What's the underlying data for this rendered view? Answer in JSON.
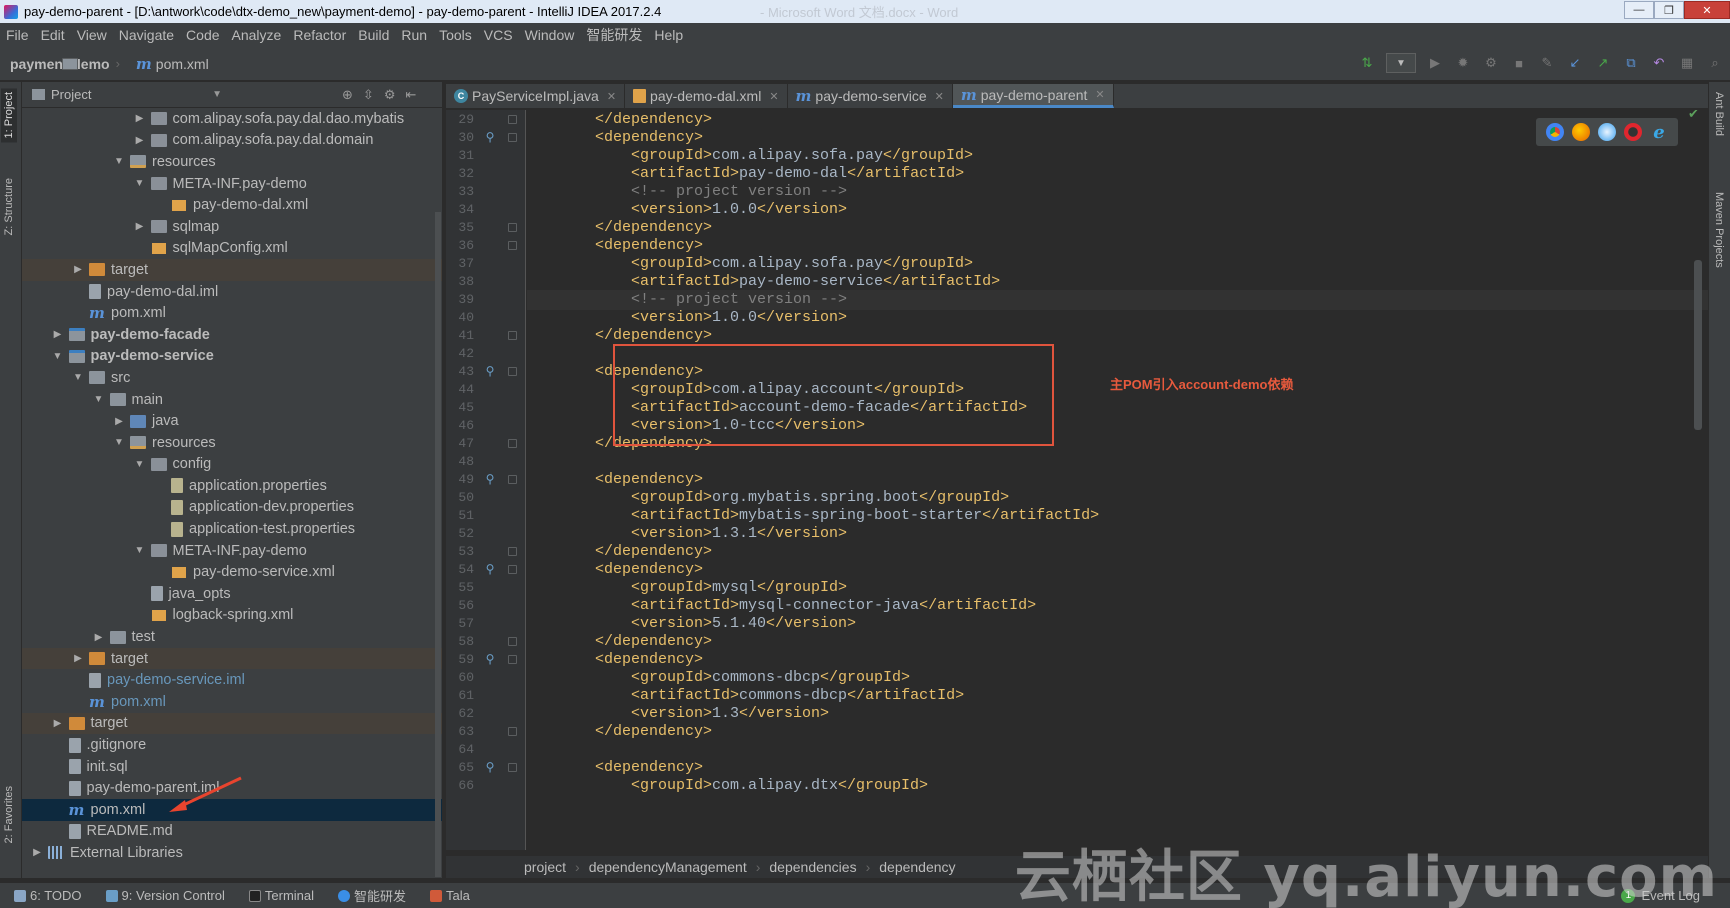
{
  "window": {
    "title": "pay-demo-parent - [D:\\antwork\\code\\dtx-demo_new\\payment-demo] - pay-demo-parent - IntelliJ IDEA 2017.2.4",
    "ghost_text": "- Microsoft Word 文档.docx - Word",
    "min_label": "—",
    "max_label": "❐",
    "close_label": "✕"
  },
  "menu": [
    "File",
    "Edit",
    "View",
    "Navigate",
    "Code",
    "Analyze",
    "Refactor",
    "Build",
    "Run",
    "Tools",
    "VCS",
    "Window",
    "智能研发",
    "Help"
  ],
  "navbar": {
    "project": "payment-demo",
    "file": "pom.xml"
  },
  "left_stripe": {
    "project": "1: Project",
    "structure": "Z: Structure",
    "favorites": "2: Favorites"
  },
  "right_stripe": {
    "ant": "Ant Build",
    "maven": "Maven Projects"
  },
  "project_panel": {
    "title": "Project",
    "tree": [
      {
        "label": "com.alipay.sofa.pay.dal.dao.mybatis",
        "icon": "package",
        "depth": 5,
        "arrow": "▶"
      },
      {
        "label": "com.alipay.sofa.pay.dal.domain",
        "icon": "package",
        "depth": 5,
        "arrow": "▶"
      },
      {
        "label": "resources",
        "icon": "resources-folder",
        "depth": 4,
        "arrow": "▼"
      },
      {
        "label": "META-INF.pay-demo",
        "icon": "package",
        "depth": 5,
        "arrow": "▼"
      },
      {
        "label": "pay-demo-dal.xml",
        "icon": "xml",
        "depth": 6,
        "arrow": ""
      },
      {
        "label": "sqlmap",
        "icon": "package",
        "depth": 5,
        "arrow": "▶"
      },
      {
        "label": "sqlMapConfig.xml",
        "icon": "xml",
        "depth": 5,
        "arrow": ""
      },
      {
        "label": "target",
        "icon": "target",
        "depth": 2,
        "arrow": "▶",
        "highlight": true
      },
      {
        "label": "pay-demo-dal.iml",
        "icon": "file",
        "depth": 2,
        "arrow": ""
      },
      {
        "label": "pom.xml",
        "icon": "maven",
        "depth": 2,
        "arrow": ""
      },
      {
        "label": "pay-demo-facade",
        "icon": "module",
        "depth": 1,
        "arrow": "▶",
        "bold": true
      },
      {
        "label": "pay-demo-service",
        "icon": "module",
        "depth": 1,
        "arrow": "▼",
        "bold": true
      },
      {
        "label": "src",
        "icon": "folder",
        "depth": 2,
        "arrow": "▼"
      },
      {
        "label": "main",
        "icon": "folder",
        "depth": 3,
        "arrow": "▼"
      },
      {
        "label": "java",
        "icon": "source-folder",
        "depth": 4,
        "arrow": "▶"
      },
      {
        "label": "resources",
        "icon": "resources-folder",
        "depth": 4,
        "arrow": "▼"
      },
      {
        "label": "config",
        "icon": "package",
        "depth": 5,
        "arrow": "▼"
      },
      {
        "label": "application.properties",
        "icon": "properties",
        "depth": 6,
        "arrow": ""
      },
      {
        "label": "application-dev.properties",
        "icon": "properties",
        "depth": 6,
        "arrow": ""
      },
      {
        "label": "application-test.properties",
        "icon": "properties",
        "depth": 6,
        "arrow": ""
      },
      {
        "label": "META-INF.pay-demo",
        "icon": "package",
        "depth": 5,
        "arrow": "▼"
      },
      {
        "label": "pay-demo-service.xml",
        "icon": "xml",
        "depth": 6,
        "arrow": ""
      },
      {
        "label": "java_opts",
        "icon": "file",
        "depth": 5,
        "arrow": ""
      },
      {
        "label": "logback-spring.xml",
        "icon": "xml",
        "depth": 5,
        "arrow": ""
      },
      {
        "label": "test",
        "icon": "folder",
        "depth": 3,
        "arrow": "▶"
      },
      {
        "label": "target",
        "icon": "target",
        "depth": 2,
        "arrow": "▶",
        "highlight": true
      },
      {
        "label": "pay-demo-service.iml",
        "icon": "file",
        "depth": 2,
        "arrow": "",
        "blue": true
      },
      {
        "label": "pom.xml",
        "icon": "maven",
        "depth": 2,
        "arrow": "",
        "blue": true
      },
      {
        "label": "target",
        "icon": "target",
        "depth": 1,
        "arrow": "▶",
        "highlight": true
      },
      {
        "label": ".gitignore",
        "icon": "file",
        "depth": 1,
        "arrow": ""
      },
      {
        "label": "init.sql",
        "icon": "file",
        "depth": 1,
        "arrow": ""
      },
      {
        "label": "pay-demo-parent.iml",
        "icon": "file",
        "depth": 1,
        "arrow": ""
      },
      {
        "label": "pom.xml",
        "icon": "maven",
        "depth": 1,
        "arrow": "",
        "selected": true
      },
      {
        "label": "README.md",
        "icon": "file",
        "depth": 1,
        "arrow": ""
      },
      {
        "label": "External Libraries",
        "icon": "library",
        "depth": 0,
        "arrow": "▶"
      }
    ]
  },
  "tabs": [
    {
      "label": "PayServiceImpl.java",
      "icon": "class"
    },
    {
      "label": "pay-demo-dal.xml",
      "icon": "xml"
    },
    {
      "label": "pay-demo-service",
      "icon": "maven"
    },
    {
      "label": "pay-demo-parent",
      "icon": "maven",
      "active": true
    }
  ],
  "editor": {
    "first_line": 29,
    "lines": [
      {
        "indent": 2,
        "segs": [
          [
            "tag",
            "</dependency>"
          ]
        ]
      },
      {
        "indent": 2,
        "segs": [
          [
            "tag",
            "<dependency>"
          ]
        ],
        "mark": true
      },
      {
        "indent": 3,
        "segs": [
          [
            "tag",
            "<groupId>"
          ],
          [
            "val",
            "com.alipay.sofa.pay"
          ],
          [
            "tag",
            "</groupId>"
          ]
        ]
      },
      {
        "indent": 3,
        "segs": [
          [
            "tag",
            "<artifactId>"
          ],
          [
            "val",
            "pay-demo-dal"
          ],
          [
            "tag",
            "</artifactId>"
          ]
        ]
      },
      {
        "indent": 3,
        "segs": [
          [
            "cmt",
            "<!-- project version -->"
          ]
        ]
      },
      {
        "indent": 3,
        "segs": [
          [
            "tag",
            "<version>"
          ],
          [
            "val",
            "1.0.0"
          ],
          [
            "tag",
            "</version>"
          ]
        ]
      },
      {
        "indent": 2,
        "segs": [
          [
            "tag",
            "</dependency>"
          ]
        ]
      },
      {
        "indent": 2,
        "segs": [
          [
            "tag",
            "<dependency>"
          ]
        ]
      },
      {
        "indent": 3,
        "segs": [
          [
            "tag",
            "<groupId>"
          ],
          [
            "val",
            "com.alipay.sofa.pay"
          ],
          [
            "tag",
            "</groupId>"
          ]
        ]
      },
      {
        "indent": 3,
        "segs": [
          [
            "tag",
            "<artifactId>"
          ],
          [
            "val",
            "pay-demo-service"
          ],
          [
            "tag",
            "</artifactId>"
          ]
        ]
      },
      {
        "indent": 3,
        "segs": [
          [
            "cmt",
            "<!-- project version -->"
          ]
        ],
        "current": true
      },
      {
        "indent": 3,
        "segs": [
          [
            "tag",
            "<version>"
          ],
          [
            "val",
            "1.0.0"
          ],
          [
            "tag",
            "</version>"
          ]
        ]
      },
      {
        "indent": 2,
        "segs": [
          [
            "tag",
            "</dependency>"
          ]
        ]
      },
      {
        "indent": 0,
        "segs": []
      },
      {
        "indent": 2,
        "segs": [
          [
            "tag",
            "<dependency>"
          ]
        ],
        "mark": true
      },
      {
        "indent": 3,
        "segs": [
          [
            "tag",
            "<groupId>"
          ],
          [
            "val",
            "com.alipay.account"
          ],
          [
            "tag",
            "</groupId>"
          ]
        ]
      },
      {
        "indent": 3,
        "segs": [
          [
            "tag",
            "<artifactId>"
          ],
          [
            "val",
            "account-demo-facade"
          ],
          [
            "tag",
            "</artifactId>"
          ]
        ]
      },
      {
        "indent": 3,
        "segs": [
          [
            "tag",
            "<version>"
          ],
          [
            "val",
            "1.0-tcc"
          ],
          [
            "tag",
            "</version>"
          ]
        ]
      },
      {
        "indent": 2,
        "segs": [
          [
            "tag",
            "</dependency>"
          ]
        ]
      },
      {
        "indent": 0,
        "segs": []
      },
      {
        "indent": 2,
        "segs": [
          [
            "tag",
            "<dependency>"
          ]
        ],
        "mark": true
      },
      {
        "indent": 3,
        "segs": [
          [
            "tag",
            "<groupId>"
          ],
          [
            "val",
            "org.mybatis.spring.boot"
          ],
          [
            "tag",
            "</groupId>"
          ]
        ]
      },
      {
        "indent": 3,
        "segs": [
          [
            "tag",
            "<artifactId>"
          ],
          [
            "val",
            "mybatis-spring-boot-starter"
          ],
          [
            "tag",
            "</artifactId>"
          ]
        ]
      },
      {
        "indent": 3,
        "segs": [
          [
            "tag",
            "<version>"
          ],
          [
            "val",
            "1.3.1"
          ],
          [
            "tag",
            "</version>"
          ]
        ]
      },
      {
        "indent": 2,
        "segs": [
          [
            "tag",
            "</dependency>"
          ]
        ]
      },
      {
        "indent": 2,
        "segs": [
          [
            "tag",
            "<dependency>"
          ]
        ],
        "mark": true
      },
      {
        "indent": 3,
        "segs": [
          [
            "tag",
            "<groupId>"
          ],
          [
            "val",
            "mysql"
          ],
          [
            "tag",
            "</groupId>"
          ]
        ]
      },
      {
        "indent": 3,
        "segs": [
          [
            "tag",
            "<artifactId>"
          ],
          [
            "val",
            "mysql-connector-java"
          ],
          [
            "tag",
            "</artifactId>"
          ]
        ]
      },
      {
        "indent": 3,
        "segs": [
          [
            "tag",
            "<version>"
          ],
          [
            "val",
            "5.1.40"
          ],
          [
            "tag",
            "</version>"
          ]
        ]
      },
      {
        "indent": 2,
        "segs": [
          [
            "tag",
            "</dependency>"
          ]
        ]
      },
      {
        "indent": 2,
        "segs": [
          [
            "tag",
            "<dependency>"
          ]
        ],
        "mark": true
      },
      {
        "indent": 3,
        "segs": [
          [
            "tag",
            "<groupId>"
          ],
          [
            "val",
            "commons-dbcp"
          ],
          [
            "tag",
            "</groupId>"
          ]
        ]
      },
      {
        "indent": 3,
        "segs": [
          [
            "tag",
            "<artifactId>"
          ],
          [
            "val",
            "commons-dbcp"
          ],
          [
            "tag",
            "</artifactId>"
          ]
        ]
      },
      {
        "indent": 3,
        "segs": [
          [
            "tag",
            "<version>"
          ],
          [
            "val",
            "1.3"
          ],
          [
            "tag",
            "</version>"
          ]
        ]
      },
      {
        "indent": 2,
        "segs": [
          [
            "tag",
            "</dependency>"
          ]
        ]
      },
      {
        "indent": 0,
        "segs": []
      },
      {
        "indent": 2,
        "segs": [
          [
            "tag",
            "<dependency>"
          ]
        ],
        "mark": true
      },
      {
        "indent": 3,
        "segs": [
          [
            "tag",
            "<groupId>"
          ],
          [
            "val",
            "com.alipay.dtx"
          ],
          [
            "tag",
            "</groupId>"
          ]
        ]
      }
    ],
    "annotation": "主POM引入account-demo依赖"
  },
  "breadcrumb": [
    "project",
    "dependencyManagement",
    "dependencies",
    "dependency"
  ],
  "statusbar": {
    "todo": "6: TODO",
    "vcs": "9: Version Control",
    "terminal": "Terminal",
    "zhineng": "智能研发",
    "tala": "Tala",
    "event_log": "Event Log"
  },
  "watermark": "云栖社区 yq.aliyun.com",
  "colors": {
    "tag": "#e8bf6a",
    "value": "#a9b7c6",
    "comment": "#808080",
    "annotation": "#e85a3d"
  }
}
